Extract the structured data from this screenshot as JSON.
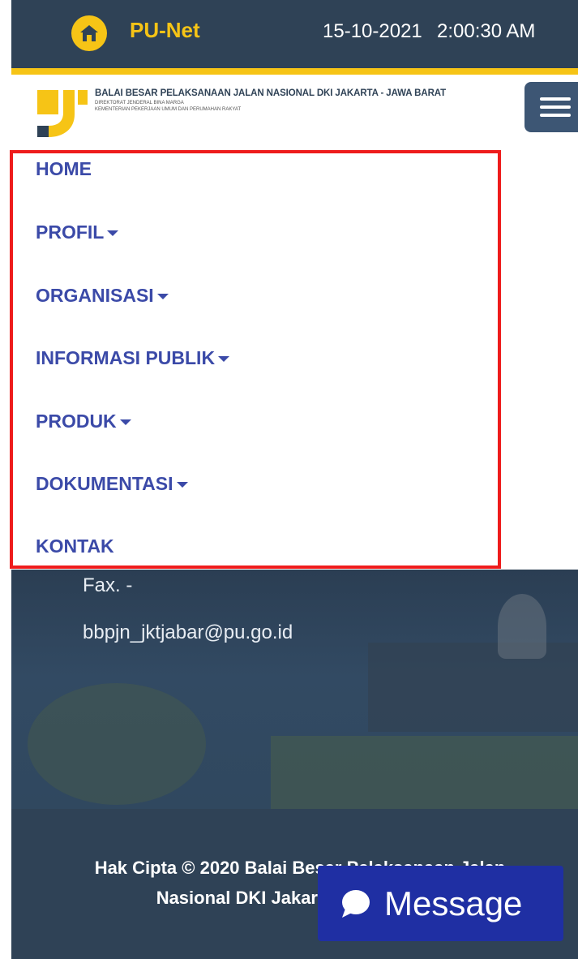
{
  "topbar": {
    "app_name": "PU-Net",
    "date": "15-10-2021",
    "time": "2:00:30 AM",
    "icon": "home-icon"
  },
  "header": {
    "org_title": "BALAI BESAR PELAKSANAAN JALAN NASIONAL DKI JAKARTA - JAWA BARAT",
    "org_sub1": "DIREKTORAT JENDERAL BINA MARGA",
    "org_sub2": "KEMENTERIAN PEKERJAAN UMUM DAN PERUMAHAN RAKYAT",
    "menu_icon": "hamburger-menu-icon"
  },
  "nav": {
    "items": [
      {
        "label": "HOME"
      },
      {
        "label": "PROFIL"
      },
      {
        "label": "ORGANISASI"
      },
      {
        "label": "INFORMASI PUBLIK"
      },
      {
        "label": "PRODUK"
      },
      {
        "label": "DOKUMENTASI"
      },
      {
        "label": "KONTAK"
      }
    ]
  },
  "contact": {
    "fax": "Fax. -",
    "email": "bbpjn_jktjabar@pu.go.id"
  },
  "footer": {
    "copyright_line1": "Hak Cipta © 2020 Balai Besar Pelaksanaan Jalan",
    "copyright_line2": "Nasional DKI Jakarta - Jawa Barat"
  },
  "message_button": {
    "label": "Message",
    "icon": "chat-bubble-icon"
  },
  "colors": {
    "brand_dark": "#2f4256",
    "brand_yellow": "#f6c416",
    "nav_text": "#3b4aa8",
    "highlight_border": "#ee1c1c",
    "message_button": "#1f2fa3"
  }
}
